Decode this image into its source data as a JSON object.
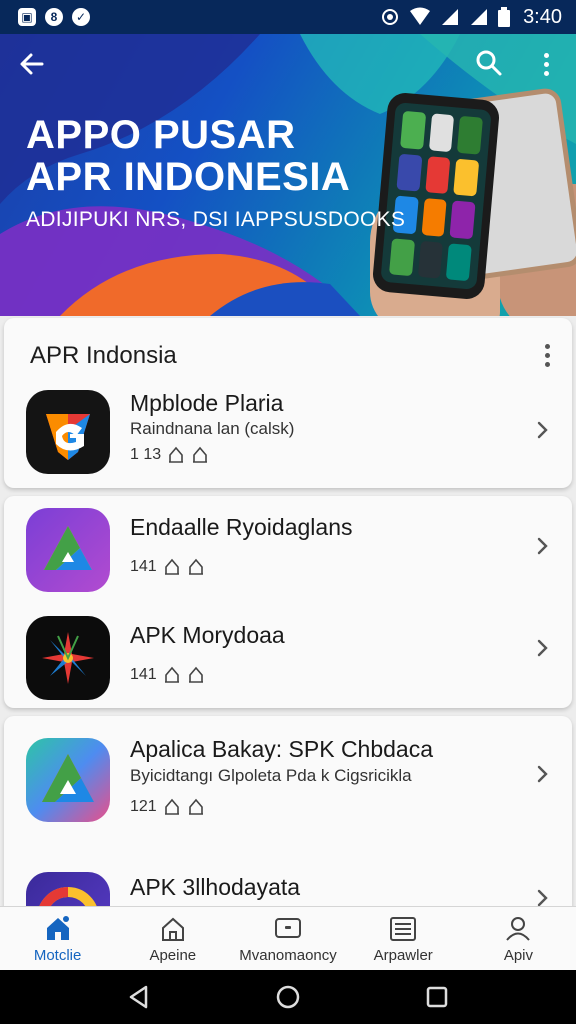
{
  "status_bar": {
    "time": "3:40"
  },
  "hero": {
    "title_line1": "APPO PUSAR",
    "title_line2": "APR INDONESIA",
    "subtitle": "ADIJIPUKI NRS, DSI IAPPSUSDOOKS"
  },
  "section": {
    "title": "APR Indonsia"
  },
  "apps": [
    {
      "name": "Mpblode Plaria",
      "desc": "Raindnana lan (calsk)",
      "meta": "1 13"
    },
    {
      "name": "Endaalle Ryoidaglans",
      "desc": "",
      "meta": "141"
    },
    {
      "name": "APK Morydoaa",
      "desc": "",
      "meta": "141"
    },
    {
      "name": "Apalica Bakay: SPK Chbdaca",
      "desc": "Byicidtangı Glpoleta Pda k Cigsricikla",
      "meta": "121"
    },
    {
      "name": "APK 3llhodayata",
      "desc": "",
      "meta": ""
    }
  ],
  "bottom_nav": [
    {
      "label": "Motclie",
      "icon": "home-icon",
      "active": true
    },
    {
      "label": "Apeine",
      "icon": "house-outline-icon",
      "active": false
    },
    {
      "label": "Mvanomaoncy",
      "icon": "tv-icon",
      "active": false
    },
    {
      "label": "Arpawler",
      "icon": "list-icon",
      "active": false
    },
    {
      "label": "Apiv",
      "icon": "person-icon",
      "active": false
    }
  ],
  "colors": {
    "accent": "#1565c0",
    "status_bar": "#07285a"
  }
}
